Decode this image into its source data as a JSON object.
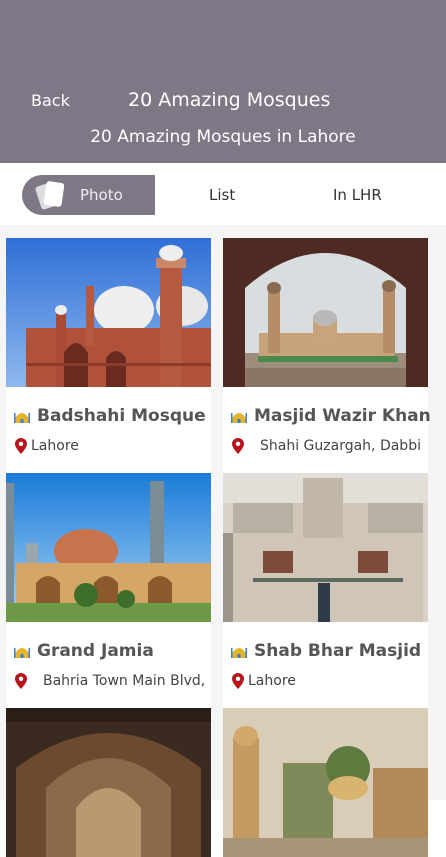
{
  "header": {
    "back_label": "Back",
    "title": "20 Amazing Mosques",
    "subtitle": "20 Amazing Mosques in Lahore",
    "color": "#7f7686"
  },
  "tabs": [
    {
      "label": "Photo",
      "active": true,
      "icon": "cards-icon"
    },
    {
      "label": "List",
      "active": false
    },
    {
      "label": "In LHR",
      "active": false
    }
  ],
  "places": [
    {
      "name": "Badshahi Mosque",
      "location": "Lahore"
    },
    {
      "name": "Masjid Wazir Khan",
      "location": "Shahi Guzargah, Dabbi"
    },
    {
      "name": "Grand Jamia",
      "location": "Bahria Town Main Blvd,"
    },
    {
      "name": "Shab Bhar Masjid",
      "location": "Lahore"
    },
    {
      "name": "",
      "location": ""
    },
    {
      "name": "",
      "location": ""
    }
  ],
  "colors": {
    "pin": "#b7141c",
    "mosque_icon_gold": "#e2b52c",
    "mosque_icon_blue": "#3e7ec4"
  }
}
